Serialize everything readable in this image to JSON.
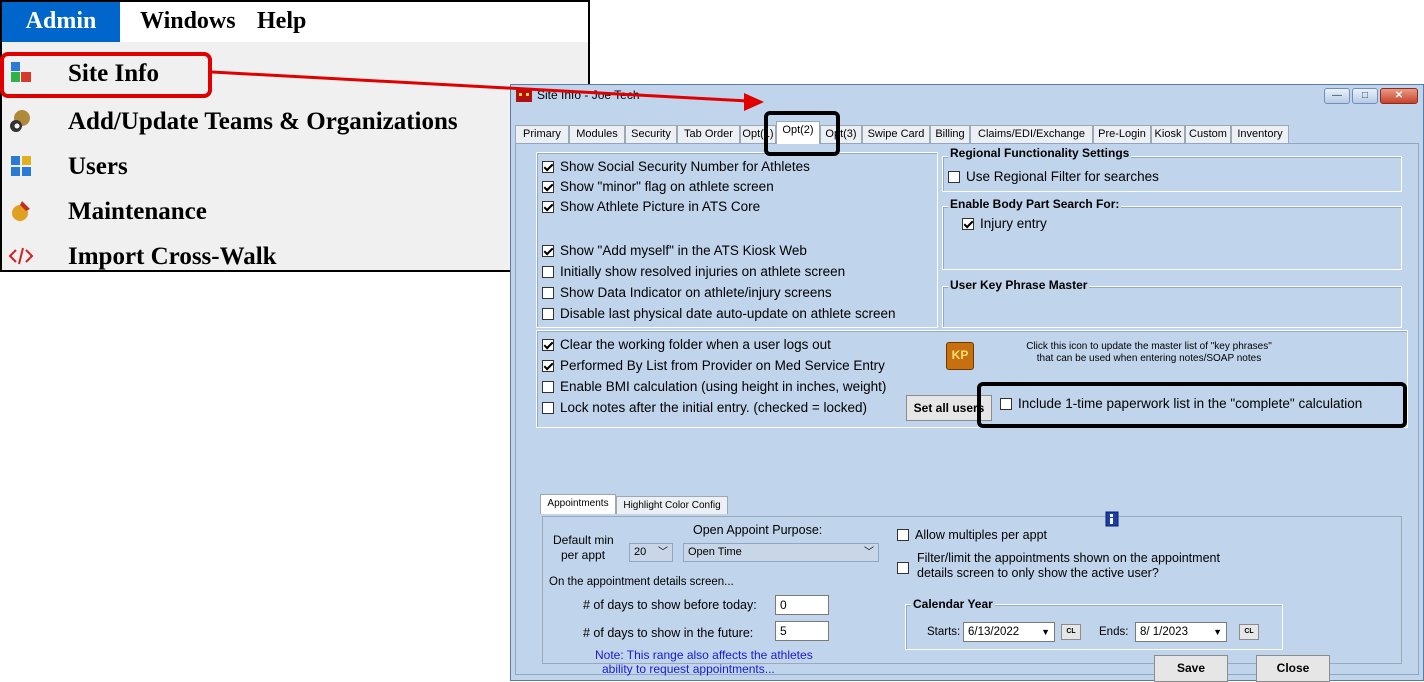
{
  "menu": {
    "bar": [
      "Admin",
      "Windows",
      "Help"
    ],
    "items": [
      {
        "label": "Site Info",
        "icon": "site-info-icon"
      },
      {
        "label": "Add/Update Teams & Organizations",
        "icon": "teams-icon"
      },
      {
        "label": "Users",
        "icon": "users-icon"
      },
      {
        "label": "Maintenance",
        "icon": "maintenance-icon"
      },
      {
        "label": "Import Cross-Walk",
        "icon": "code-icon"
      }
    ]
  },
  "dialog": {
    "title": "Site Info - Joe Tech",
    "window_buttons": {
      "minimize": "—",
      "maximize": "□",
      "close": "✕"
    },
    "tabs": [
      "Primary",
      "Modules",
      "Security",
      "Tab Order",
      "Opt(1)",
      "Opt(2)",
      "Opt(3)",
      "Swipe Card",
      "Billing",
      "Claims/EDI/Exchange",
      "Pre-Login",
      "Kiosk",
      "Custom",
      "Inventory"
    ],
    "active_tab": "Opt(2)",
    "left_options": [
      {
        "label": "Show Social Security Number for Athletes",
        "checked": true
      },
      {
        "label": "Show \"minor\" flag on athlete screen",
        "checked": true
      },
      {
        "label": "Show Athlete Picture in ATS Core",
        "checked": true
      },
      {
        "label": "Show \"Add myself\" in the ATS Kiosk Web",
        "checked": true
      },
      {
        "label": "Initially show resolved injuries on athlete screen",
        "checked": false
      },
      {
        "label": "Show Data Indicator on athlete/injury screens",
        "checked": false
      },
      {
        "label": "Disable last physical date auto-update on athlete screen",
        "checked": false
      },
      {
        "label": "Clear the working folder when a user logs out",
        "checked": true
      },
      {
        "label": "Performed By List from Provider on Med Service Entry",
        "checked": true
      },
      {
        "label": "Enable BMI calculation (using height in inches, weight)",
        "checked": false
      },
      {
        "label": "Lock notes after the initial entry.  (checked = locked)",
        "checked": false
      }
    ],
    "set_all_users": "Set all users",
    "regional": {
      "title": "Regional Functionality Settings",
      "option": "Use Regional Filter for searches",
      "checked": false
    },
    "body_part": {
      "title": "Enable Body Part Search For:",
      "option": "Injury entry",
      "checked": true
    },
    "key_phrase": {
      "title": "User Key Phrase Master",
      "icon_text": "KP",
      "line1": "Click this icon to update the master list of \"key phrases\"",
      "line2": "that can be used when entering notes/SOAP notes"
    },
    "paperwork": {
      "label": "Include 1-time paperwork list in the \"complete\" calculation",
      "checked": false
    },
    "subtabs": [
      "Appointments",
      "Highlight Color Config"
    ],
    "appointments": {
      "default_min_label_1": "Default min",
      "default_min_label_2": "per appt",
      "default_min_value": "20",
      "purpose_label": "Open Appoint Purpose:",
      "purpose_value": "Open Time",
      "details_heading": "On the appointment details screen...",
      "days_before_label": "# of days to show before today:",
      "days_before_value": "0",
      "days_future_label": "# of days to show in the future:",
      "days_future_value": "5",
      "note_1": "Note:  This range also affects the athletes",
      "note_2": "ability to request appointments...",
      "allow_multiples": "Allow multiples per appt",
      "filter_line1": "Filter/limit the appointments shown on the appointment",
      "filter_line2": "details screen to only show the active user?",
      "calendar_title": "Calendar Year",
      "starts_label": "Starts:",
      "starts_value": "6/13/2022",
      "ends_label": "Ends:",
      "ends_value": "8/ 1/2023",
      "cl_label": "CL"
    },
    "save": "Save",
    "close": "Close"
  },
  "colors": {
    "menu_highlight": "#0066cc",
    "callout_red": "#e00000",
    "dialog_bg": "#c0d4ec"
  }
}
